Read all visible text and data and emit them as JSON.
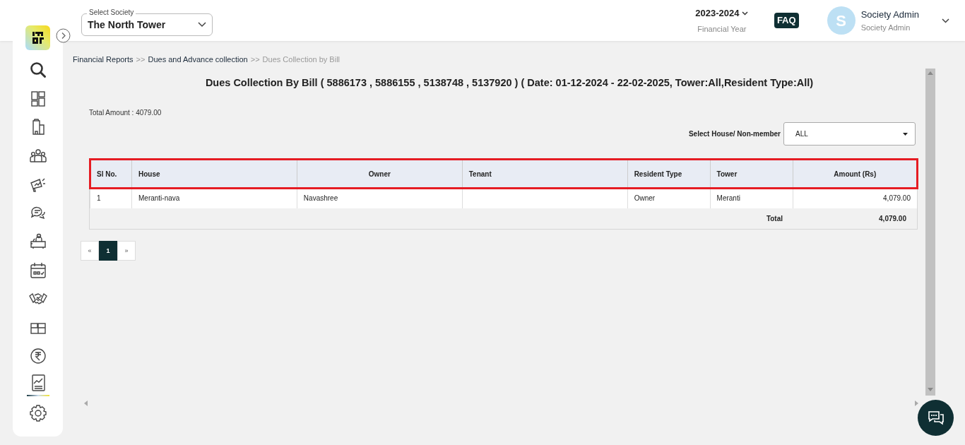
{
  "header": {
    "society_select": {
      "label": "Select Society",
      "value": "The North Tower"
    },
    "financial_year": {
      "value": "2023-2024",
      "caption": "Financial Year"
    },
    "faq": "FAQ",
    "user": {
      "initial": "S",
      "name": "Society Admin",
      "role": "Society Admin"
    }
  },
  "sidebar": {
    "items": [
      {
        "selected": false
      },
      {
        "selected": false
      },
      {
        "selected": false
      },
      {
        "selected": false
      },
      {
        "selected": false
      },
      {
        "selected": false
      },
      {
        "selected": false
      },
      {
        "selected": false
      },
      {
        "selected": false
      },
      {
        "selected": false
      },
      {
        "selected": false
      },
      {
        "selected": true
      },
      {
        "selected": false
      }
    ]
  },
  "breadcrumb": [
    {
      "text": "Financial Reports",
      "kind": "link"
    },
    {
      "text": ">>",
      "kind": "separator"
    },
    {
      "text": "Dues and Advance collection",
      "kind": "link"
    },
    {
      "text": ">>",
      "kind": "separator"
    },
    {
      "text": "Dues Collection by Bill",
      "kind": "current"
    }
  ],
  "report": {
    "title": "Dues Collection By Bill ( 5886173 , 5886155 , 5138748 , 5137920 ) ( Date: 01-12-2024 - 22-02-2025, Tower:All,Resident Type:All)",
    "total_amount": "Total Amount : 4079.00",
    "filter": {
      "label": "Select House/ Non-member",
      "value": "ALL"
    },
    "table": {
      "columns": [
        {
          "label": "Sl No."
        },
        {
          "label": "House"
        },
        {
          "label": "Owner"
        },
        {
          "label": "Tenant"
        },
        {
          "label": "Resident Type"
        },
        {
          "label": "Tower"
        },
        {
          "label": "Amount (Rs)"
        }
      ],
      "rows": [
        [
          "1",
          "Meranti-nava",
          "Navashree",
          "",
          "Owner",
          "Meranti",
          "4,079.00"
        ]
      ],
      "footer": {
        "label": "Total",
        "value": "4,079.00"
      }
    },
    "pagination": [
      {
        "label": "«",
        "selected": false
      },
      {
        "label": "1",
        "selected": true
      },
      {
        "label": "»",
        "selected": false
      }
    ]
  }
}
